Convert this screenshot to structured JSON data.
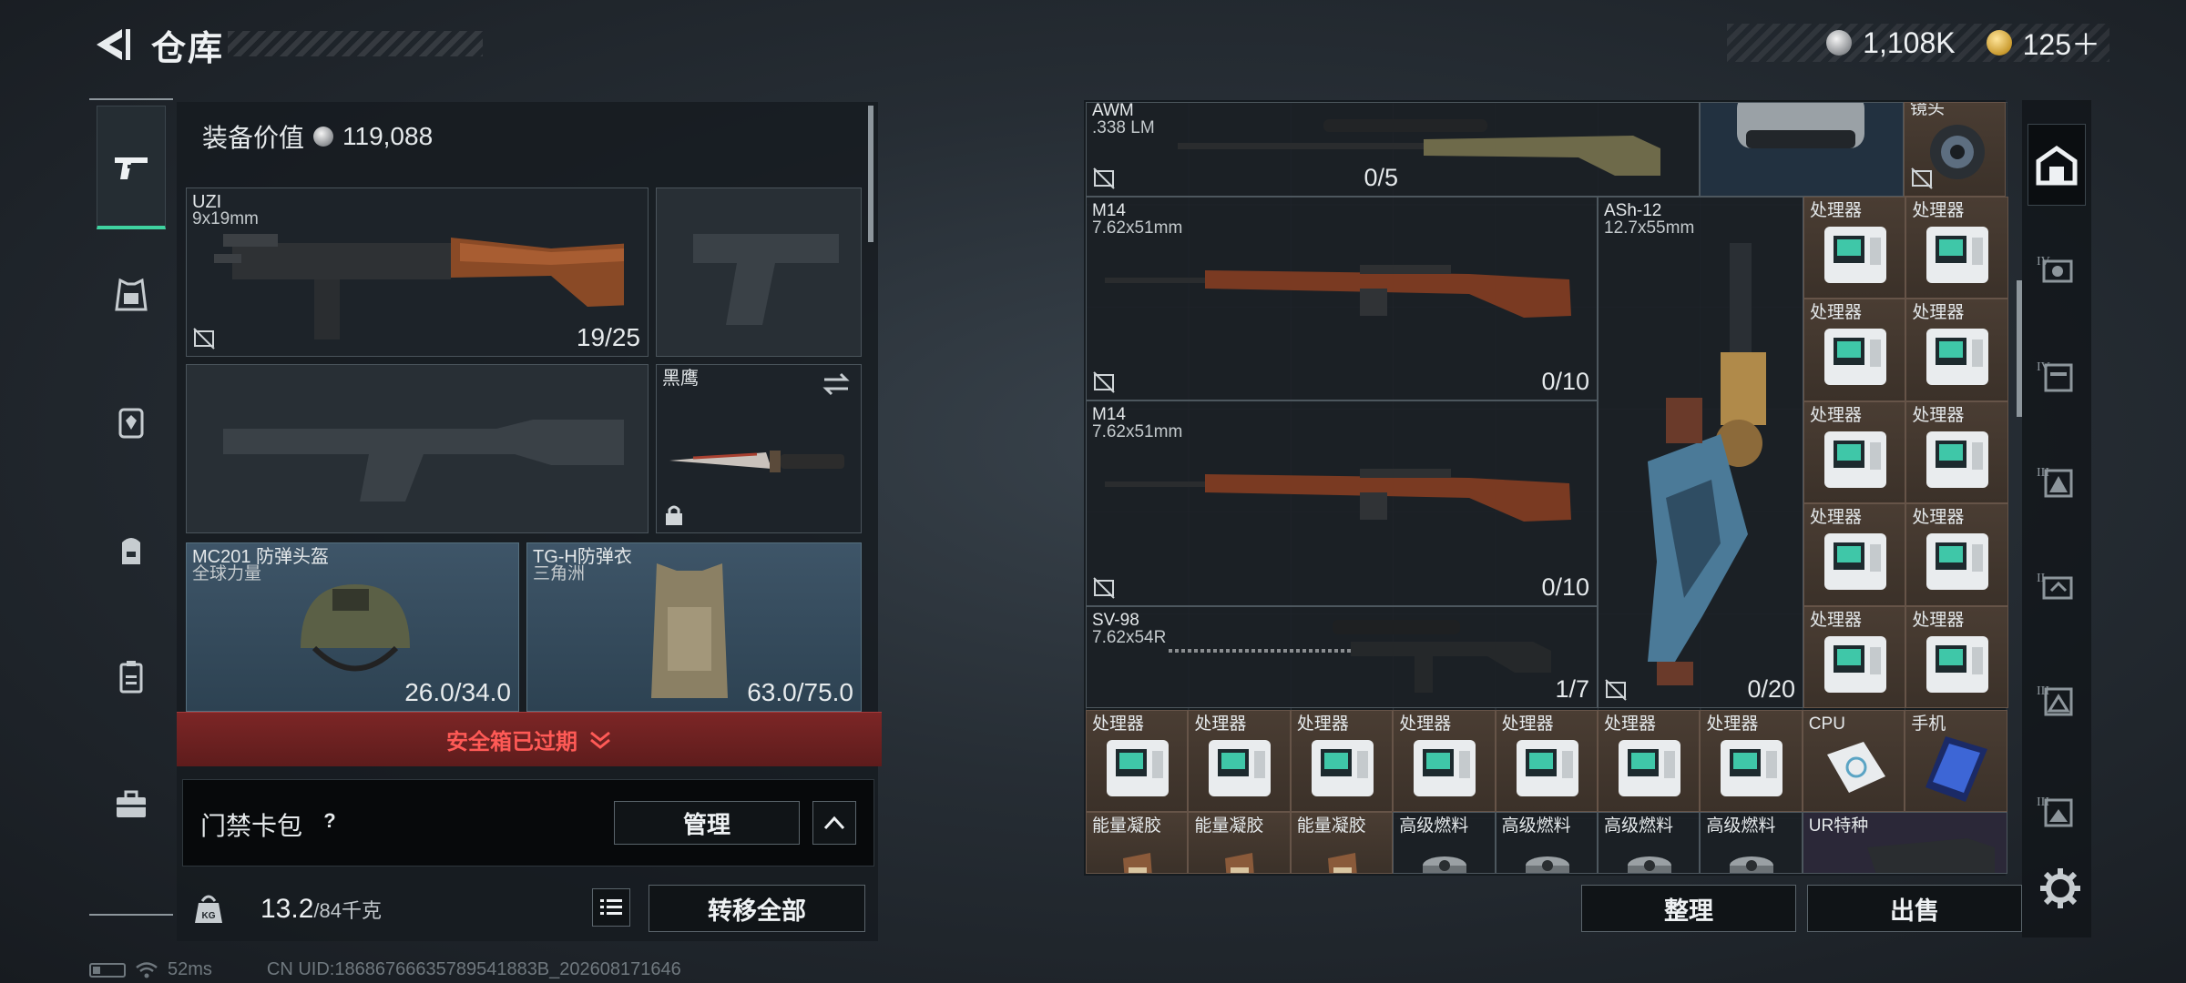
{
  "header": {
    "title": "仓库",
    "silver": "1,108K",
    "gold": "125＋"
  },
  "loadout": {
    "equip_value_label": "装备价值",
    "equip_value": "119,088",
    "primary": {
      "name": "UZI",
      "caliber": "9x19mm",
      "ammo": "19/25"
    },
    "melee": {
      "name": "黑鹰"
    },
    "helmet": {
      "name": "MC201 防弹头盔",
      "faction": "全球力量",
      "durability": "26.0/34.0"
    },
    "armor": {
      "name": "TG-H防弹衣",
      "faction": "三角洲",
      "durability": "63.0/75.0"
    },
    "safebox_status": "安全箱已过期",
    "keycard_label": "门禁卡包",
    "help_symbol": "?",
    "manage_label": "管理",
    "weight": "13.2",
    "weight_max": "/84千克",
    "transfer_all_label": "转移全部"
  },
  "status": {
    "ping": "52ms",
    "uid": "CN UID:18686766635789541883B_202608171646"
  },
  "stash": {
    "awm": {
      "name": "AWM",
      "caliber": ".338 LM",
      "ammo": "0/5"
    },
    "lens": {
      "name": "镜头"
    },
    "m14_a": {
      "name": "M14",
      "caliber": "7.62x51mm",
      "ammo": "0/10"
    },
    "m14_b": {
      "name": "M14",
      "caliber": "7.62x51mm",
      "ammo": "0/10"
    },
    "sv98": {
      "name": "SV-98",
      "caliber": "7.62x54R",
      "ammo": "1/7"
    },
    "ash12": {
      "name": "ASh-12",
      "caliber": "12.7x55mm",
      "ammo": "0/20"
    },
    "processor_label": "处理器",
    "cpu_label": "CPU",
    "phone_label": "手机",
    "gel_label": "能量凝胶",
    "fuel_label": "高级燃料",
    "ur_label": "UR特种",
    "sort_label": "整理",
    "sell_label": "出售"
  }
}
